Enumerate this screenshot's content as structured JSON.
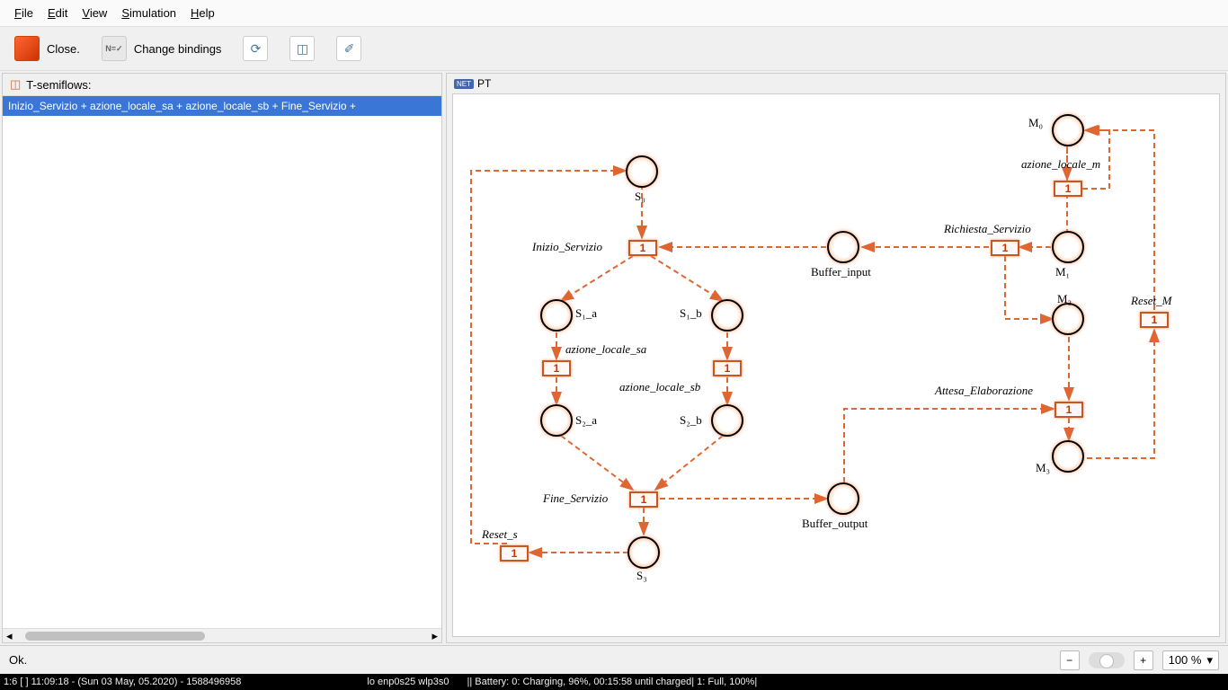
{
  "menu": {
    "file": "File",
    "edit": "Edit",
    "view": "View",
    "simulation": "Simulation",
    "help": "Help"
  },
  "toolbar": {
    "close": "Close.",
    "change": "Change bindings"
  },
  "left": {
    "header": "T-semiflows:",
    "selected": "Inizio_Servizio + azione_locale_sa + azione_locale_sb + Fine_Servizio +"
  },
  "canvas": {
    "title": "PT",
    "badge": "NET"
  },
  "labels": {
    "s0": "S₀",
    "s1a": "S₁_a",
    "s1b": "S₁_b",
    "s2a": "S₂_a",
    "s2b": "S₂_b",
    "s3": "S₃",
    "m0": "M₀",
    "m1": "M₁",
    "m2": "M₂",
    "m3": "M₃",
    "buf_in": "Buffer_input",
    "buf_out": "Buffer_output",
    "t_init": "Inizio_Servizio",
    "t_azsa": "azione_locale_sa",
    "t_azsb": "azione_locale_sb",
    "t_fine": "Fine_Servizio",
    "t_resets": "Reset_s",
    "t_azm": "azione_locale_m",
    "t_rich": "Richiesta_Servizio",
    "t_resetm": "Reset_M",
    "t_att": "Attesa_Elaborazione"
  },
  "transval": "1",
  "status": {
    "msg": "Ok.",
    "zoom": "100 %"
  },
  "sysbar": {
    "left": "1:6 [ ]    11:09:18 - (Sun 03 May, 05.2020) - 1588496958",
    "mid": "lo enp0s25 wlp3s0",
    "right": "||   Battery: 0: Charging, 96%, 00:15:58 until charged| 1: Full, 100%|"
  }
}
